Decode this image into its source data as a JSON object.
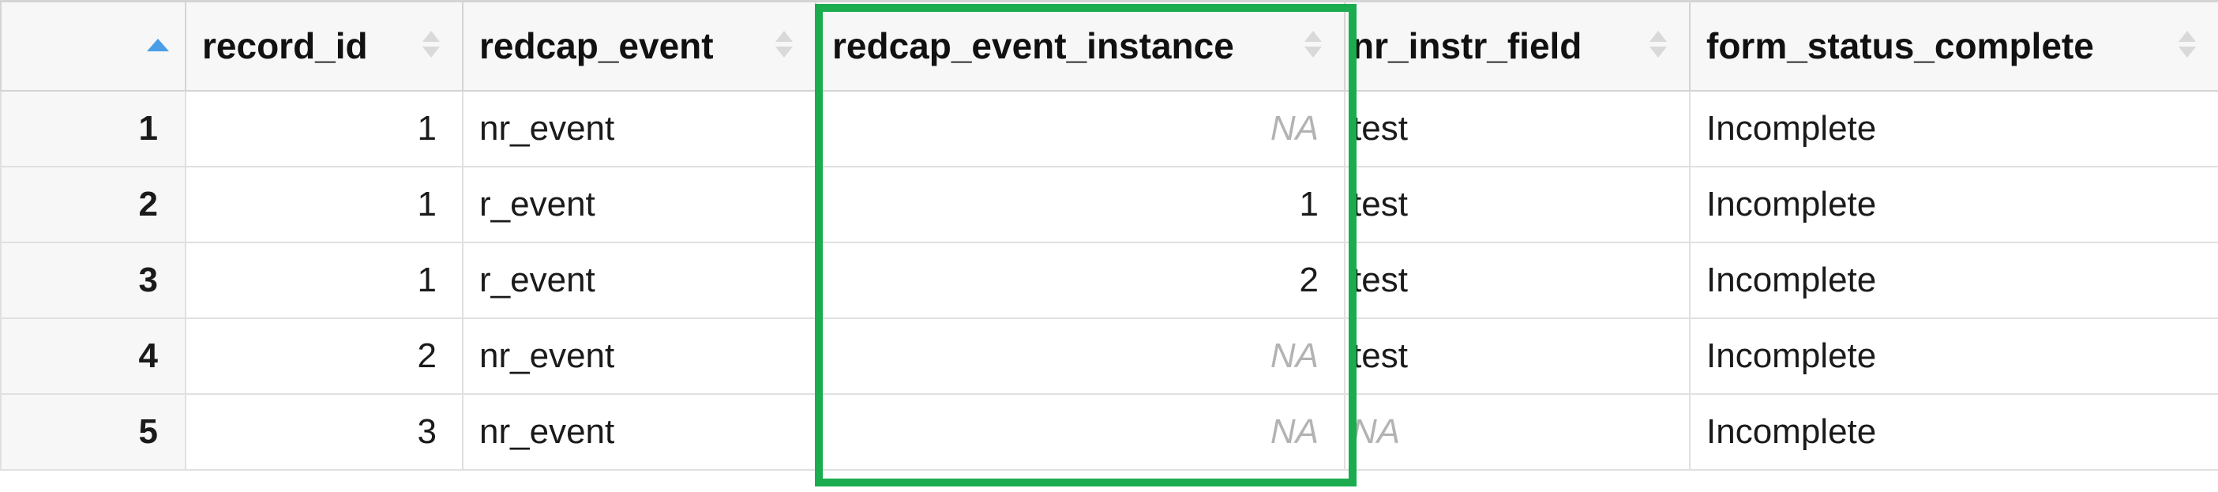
{
  "table": {
    "columns": [
      {
        "key": "index",
        "label": ""
      },
      {
        "key": "record_id",
        "label": "record_id"
      },
      {
        "key": "redcap_event",
        "label": "redcap_event"
      },
      {
        "key": "redcap_event_instance",
        "label": "redcap_event_instance"
      },
      {
        "key": "nr_instr_field",
        "label": "nr_instr_field"
      },
      {
        "key": "form_status_complete",
        "label": "form_status_complete"
      }
    ],
    "rows": [
      {
        "index": "1",
        "record_id": "1",
        "redcap_event": "nr_event",
        "redcap_event_instance": "NA",
        "nr_instr_field": "test",
        "form_status_complete": "Incomplete"
      },
      {
        "index": "2",
        "record_id": "1",
        "redcap_event": "r_event",
        "redcap_event_instance": "1",
        "nr_instr_field": "test",
        "form_status_complete": "Incomplete"
      },
      {
        "index": "3",
        "record_id": "1",
        "redcap_event": "r_event",
        "redcap_event_instance": "2",
        "nr_instr_field": "test",
        "form_status_complete": "Incomplete"
      },
      {
        "index": "4",
        "record_id": "2",
        "redcap_event": "nr_event",
        "redcap_event_instance": "NA",
        "nr_instr_field": "test",
        "form_status_complete": "Incomplete"
      },
      {
        "index": "5",
        "record_id": "3",
        "redcap_event": "nr_event",
        "redcap_event_instance": "NA",
        "nr_instr_field": "NA",
        "form_status_complete": "Incomplete"
      }
    ]
  },
  "colors": {
    "highlight": "#1aac4e",
    "sort_active": "#4a9ee6",
    "na_text": "#b3b3b3"
  },
  "icons": {
    "sort_active": "sort-ascending-icon",
    "sort_inactive": "sort-both-icon"
  }
}
